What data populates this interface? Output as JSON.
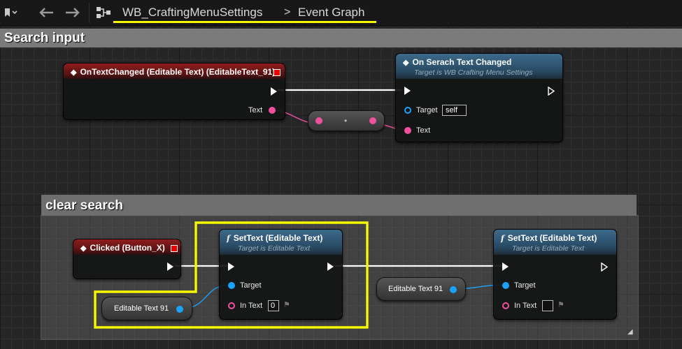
{
  "breadcrumb": {
    "blueprint": "WB_CraftingMenuSettings",
    "separator": ">",
    "graph": "Event Graph"
  },
  "icons": {
    "bookmark": "bookmark-icon",
    "back": "back-arrow-icon",
    "forward": "forward-arrow-icon",
    "graph": "graph-icon"
  },
  "comments": {
    "search": "Search input",
    "clear": "clear search"
  },
  "nodes": {
    "on_text_changed": {
      "title": "OnTextChanged (Editable Text) (EditableText_91)",
      "pin_text": "Text"
    },
    "on_search_text_changed": {
      "title": "On Serach Text Changed",
      "subtitle": "Target is WB Crafting Menu Settings",
      "target_label": "Target",
      "target_value": "self",
      "text_label": "Text"
    },
    "reroute": {
      "label": "•"
    },
    "clicked": {
      "title": "Clicked (Button_X)"
    },
    "settext_1": {
      "title": "SetText (Editable Text)",
      "subtitle": "Target is Editable Text",
      "target_label": "Target",
      "intext_label": "In Text",
      "intext_value": "0"
    },
    "settext_2": {
      "title": "SetText (Editable Text)",
      "subtitle": "Target is Editable Text",
      "target_label": "Target",
      "intext_label": "In Text",
      "intext_value": ""
    },
    "var_1": {
      "label": "Editable Text 91"
    },
    "var_2": {
      "label": "Editable Text 91"
    }
  },
  "colors": {
    "highlight": "#f7f700",
    "event_header": "#8e1e1e",
    "function_header": "#3d6a8c",
    "object_pin": "#1aa3ff",
    "text_pin": "#f0509e"
  }
}
